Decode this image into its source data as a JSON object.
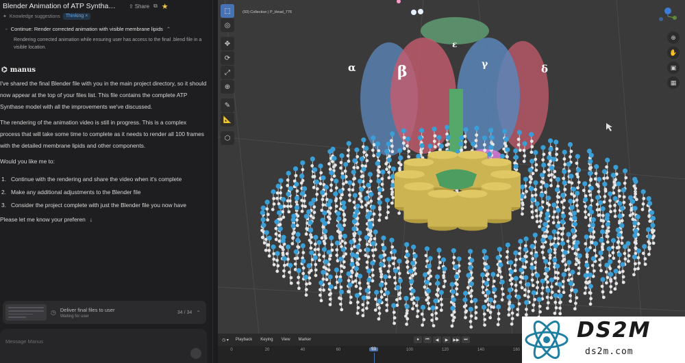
{
  "chat": {
    "title": "Blender Animation of ATP Syntha…",
    "share_label": "Share",
    "suggestions_label": "Knowledge suggestions",
    "suggestions_chip": "Thinking",
    "task_title": "Continue: Render corrected animation with visible membrane lipids",
    "task_description": "Rendering corrected animation while ensuring user has access to the final .blend file in a visible location.",
    "agent_name": "manus",
    "paragraphs": [
      "I've shared the final Blender file with you in the main project directory, so it should now appear at the top of your files list. This file contains the complete ATP Synthase model with all the improvements we've discussed.",
      "The rendering of the animation video is still in progress. This is a complex process that will take some time to complete as it needs to render all 100 frames with the detailed membrane lipids and other components.",
      "Would you like me to:"
    ],
    "options": [
      {
        "num": "1.",
        "text": "Continue with the rendering and share the video when it's complete"
      },
      {
        "num": "2.",
        "text": "Make any additional adjustments to the Blender file"
      },
      {
        "num": "3.",
        "text": "Consider the project complete with just the Blender file you now have"
      }
    ],
    "closing": "Please let me know your preferen",
    "progress_title": "Deliver final files to user",
    "progress_sub": "Waiting for user",
    "progress_count": "34 / 34",
    "input_placeholder": "Message Manus"
  },
  "viewport": {
    "info_text": "(93) Collection | P_Head_776",
    "labels": {
      "alpha": "α",
      "beta": "β",
      "gamma": "γ",
      "epsilon": "ε",
      "delta": "δ"
    }
  },
  "timeline": {
    "menus": [
      "Playback",
      "Keying",
      "View",
      "Marker"
    ],
    "ticks": [
      "0",
      "20",
      "40",
      "60",
      "80",
      "100",
      "120",
      "140",
      "160"
    ],
    "current_frame": "93"
  },
  "watermark": {
    "title": "DS2M",
    "url": "ds2m.com"
  },
  "colors": {
    "lipid_head": "#3a9fd6",
    "lipid_tail": "#e6e6e6",
    "c_ring": "#cdb452",
    "alpha": "#5b86b8",
    "beta": "#c75c6e",
    "stalk": "#55a86a",
    "accent": "#4772b3"
  }
}
